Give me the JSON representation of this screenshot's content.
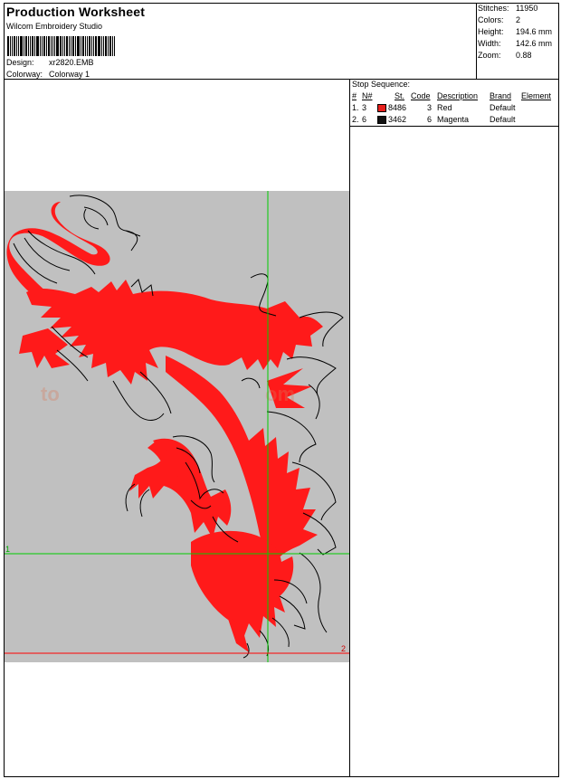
{
  "header": {
    "title": "Production Worksheet",
    "software": "Wilcom Embroidery Studio",
    "design_label": "Design:",
    "design_value": "xr2820.EMB",
    "colorway_label": "Colorway:",
    "colorway_value": "Colorway 1"
  },
  "stats": [
    {
      "label": "Stitches:",
      "value": "11950"
    },
    {
      "label": "Colors:",
      "value": "2"
    },
    {
      "label": "Height:",
      "value": "194.6 mm"
    },
    {
      "label": "Width:",
      "value": "142.6 mm"
    },
    {
      "label": "Zoom:",
      "value": "0.88"
    }
  ],
  "stop_sequence": {
    "caption": "Stop Sequence:",
    "columns": [
      "#",
      "N#",
      "St.",
      "Code",
      "Description",
      "Brand",
      "Element"
    ],
    "rows": [
      {
        "num": "1.",
        "n": "3",
        "swatch_color": "#e8201c",
        "code": "8486",
        "st": "3",
        "description": "Red",
        "brand": "Default"
      },
      {
        "num": "2.",
        "n": "6",
        "swatch_color": "#111111",
        "code": "3462",
        "st": "6",
        "description": "Magenta",
        "brand": "Default"
      }
    ]
  },
  "preview": {
    "marker_1": "1",
    "marker_2": "2",
    "stitch_color": "#ff1a1a",
    "outline_color": "#000000",
    "guide_color": "#00cc00",
    "baseline_color": "#ff0000",
    "background_color": "#c0c0c0"
  }
}
